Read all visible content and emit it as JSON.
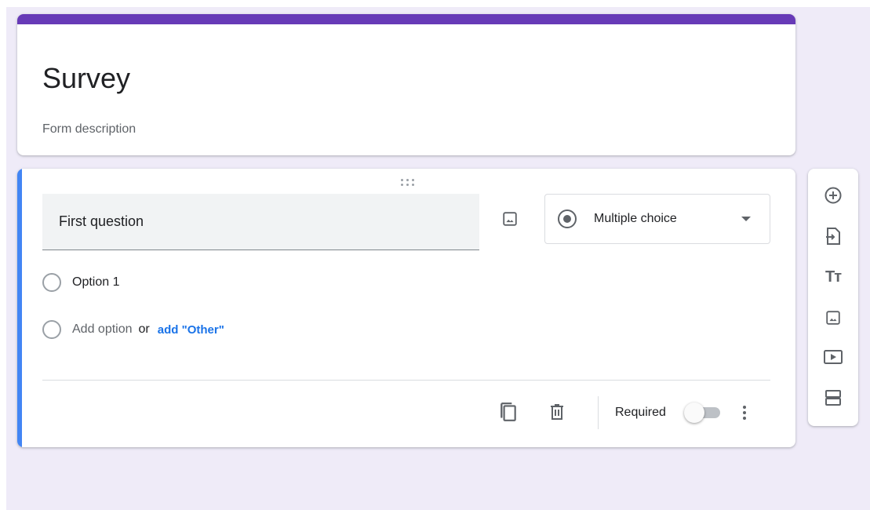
{
  "form": {
    "title": "Survey",
    "description": "Form description",
    "theme_color": "#673ab7",
    "active_accent_color": "#4285f4",
    "background_color": "#efebf8"
  },
  "question": {
    "title": "First question",
    "type_label": "Multiple choice",
    "options": [
      {
        "label": "Option 1"
      }
    ],
    "add_option_label": "Add option",
    "or_text": "or",
    "add_other_label": "add \"Other\"",
    "required_label": "Required",
    "required": false
  },
  "side_toolbar": {
    "items": [
      {
        "icon": "add-circle-icon"
      },
      {
        "icon": "import-questions-icon"
      },
      {
        "icon": "title-text-icon",
        "text": "Tт"
      },
      {
        "icon": "image-icon"
      },
      {
        "icon": "video-icon"
      },
      {
        "icon": "section-icon"
      }
    ]
  }
}
